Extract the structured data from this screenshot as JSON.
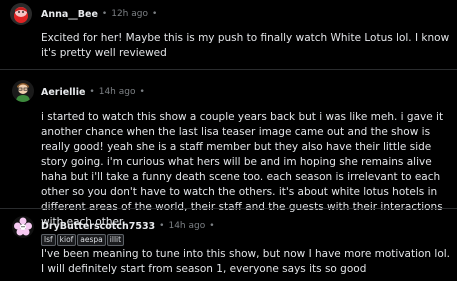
{
  "comments": [
    {
      "username": "Anna__Bee",
      "separator": "•",
      "time": "12h ago",
      "extra": "•",
      "body": "Excited for her! Maybe this is my push to finally watch White Lotus lol. I know it's pretty well reviewed"
    },
    {
      "username": "Aeriellie",
      "separator": "•",
      "time": "14h ago",
      "extra": "•",
      "body": "i started to watch this show a couple years back but i was like meh. i gave it another chance when the last lisa teaser image came out and the show is really good! yeah she is a staff member but they also have their little side story going. i'm curious what hers will be and im hoping she remains alive haha but i'll take a funny death scene too. each season is irrelevant to each other so you don't have to watch the others. it's about white lotus hotels in different areas of the world, their staff and the guests with their interactions with each other."
    },
    {
      "username": "DryButterscotch7533",
      "separator": "•",
      "time": "14h ago",
      "extra": "•",
      "flairs": [
        "lsf",
        "kiof",
        "aespa",
        "illit"
      ],
      "body": "I've been meaning to tune into this show, but now I have more motivation lol. I will definitely start from season 1, everyone says its so good"
    }
  ],
  "colors": {
    "background": "#000000",
    "text": "#e3e5e8",
    "meta": "#7c8084",
    "avatar1": "#e02424",
    "avatar3": "#f6c9f2"
  },
  "icons": {
    "avatar1": "pink-character-avatar-icon",
    "avatar2": "green-shirt-character-avatar-icon",
    "avatar3": "pink-flower-character-avatar-icon"
  }
}
